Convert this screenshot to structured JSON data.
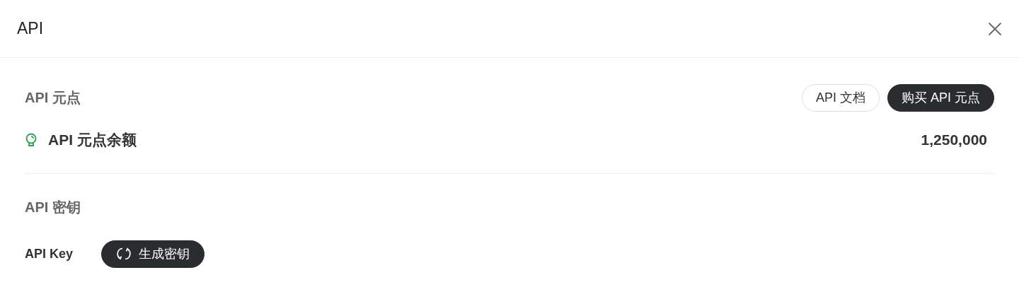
{
  "window": {
    "title": "API"
  },
  "credits": {
    "title": "API 元点",
    "buttons": [
      {
        "label": "API 文档",
        "kind": "outline"
      },
      {
        "label": "购买 API 元点",
        "kind": "filled"
      }
    ],
    "balance": {
      "label": "API 元点余额",
      "value": "1,250,000"
    }
  },
  "keys": {
    "title": "API 密钥",
    "label": "API Key",
    "button": {
      "label": "生成密钥",
      "kind": "filled"
    }
  }
}
